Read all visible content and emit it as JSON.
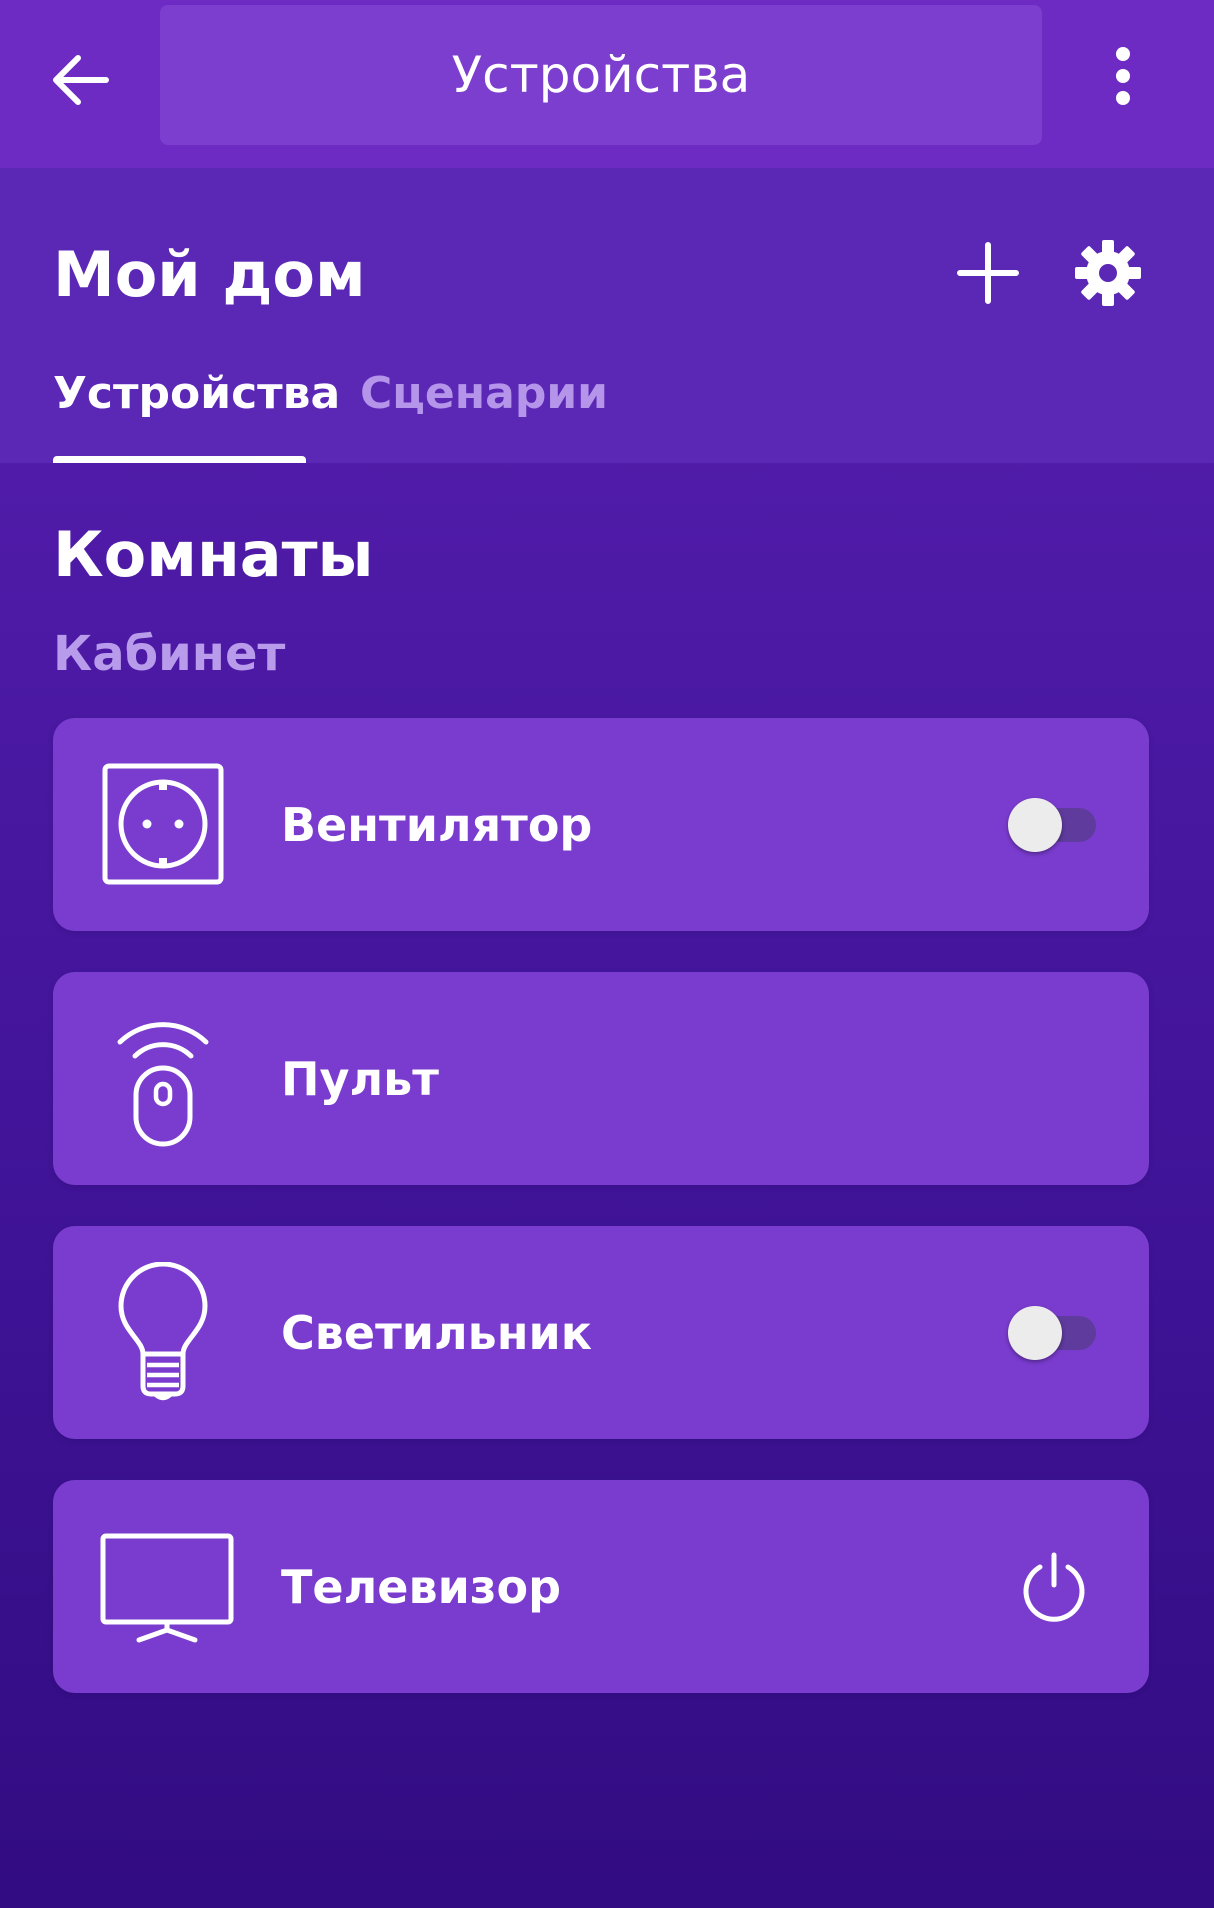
{
  "appbar": {
    "title": "Устройства",
    "back_icon": "arrow-left-icon",
    "menu_icon": "more-vertical-icon"
  },
  "home": {
    "title": "Мой дом",
    "add_icon": "plus-icon",
    "settings_icon": "gear-icon",
    "tabs": [
      {
        "label": "Устройства",
        "active": true
      },
      {
        "label": "Сценарии",
        "active": false
      }
    ]
  },
  "rooms": {
    "title": "Комнаты",
    "room_name": "Кабинет",
    "devices": [
      {
        "name": "Вентилятор",
        "icon": "socket-icon",
        "control": "toggle",
        "on": false
      },
      {
        "name": "Пульт",
        "icon": "remote-icon",
        "control": "none"
      },
      {
        "name": "Светильник",
        "icon": "bulb-icon",
        "control": "toggle",
        "on": false
      },
      {
        "name": "Телевизор",
        "icon": "tv-icon",
        "control": "power"
      }
    ]
  },
  "colors": {
    "appbar": "#6d2bc4",
    "title_box": "#7c3ece",
    "header": "#5b28b6",
    "card": "#7a3ccf",
    "room_label": "#b89bea",
    "inactive_tab": "#b495ea"
  }
}
